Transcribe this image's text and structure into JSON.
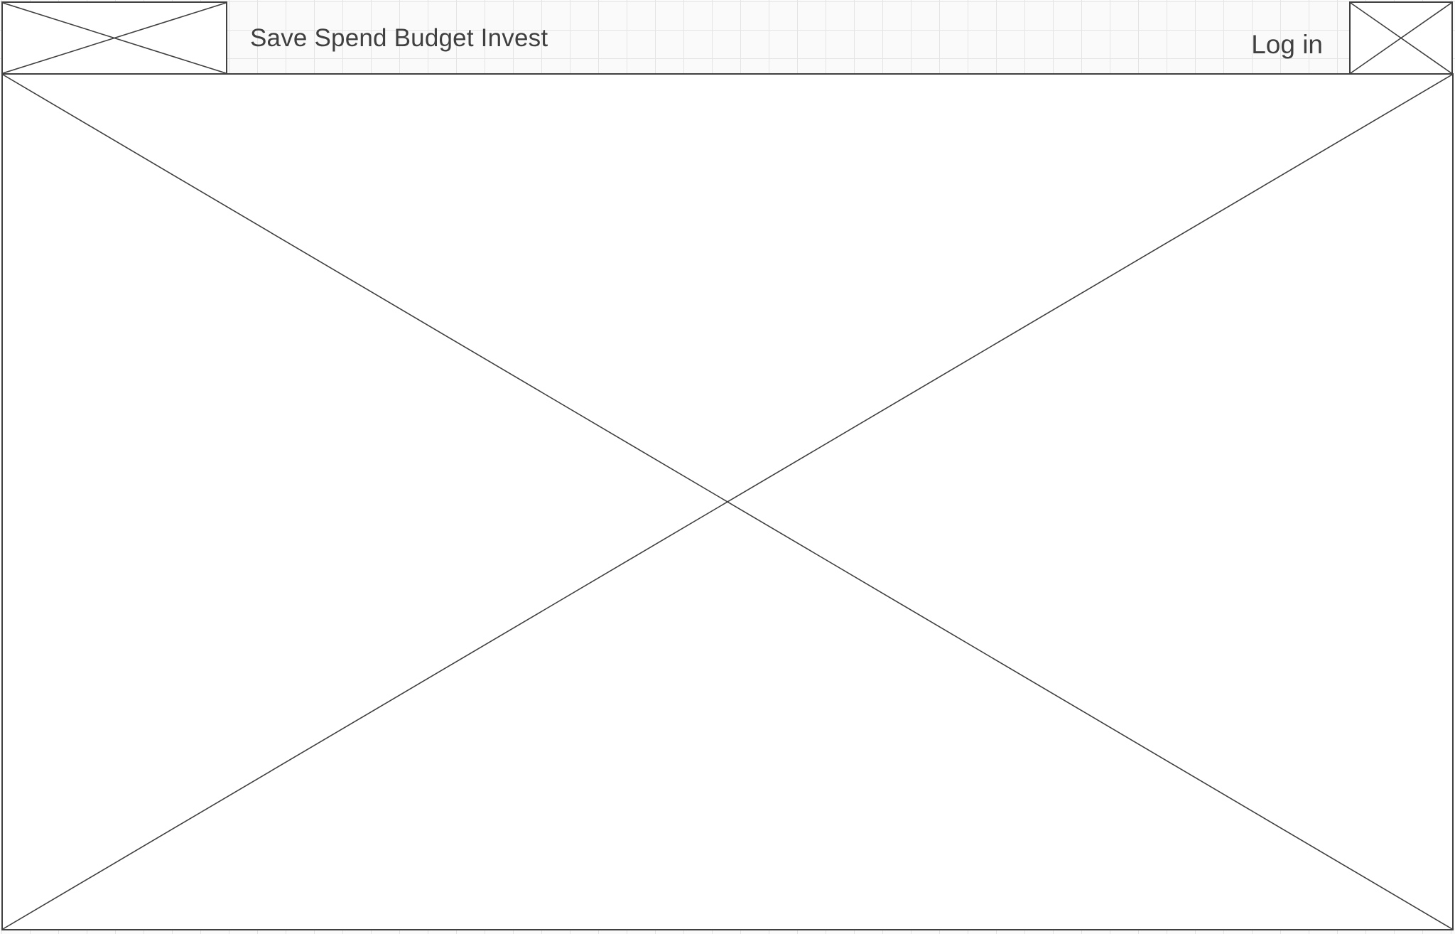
{
  "header": {
    "nav_text": "Save Spend Budget Invest",
    "login_label": "Log in"
  },
  "colors": {
    "stroke": "#404040",
    "grid": "#e4e4e4",
    "background": "#ffffff"
  },
  "placeholders": {
    "logo": "image-placeholder-icon",
    "avatar": "image-placeholder-icon",
    "hero": "image-placeholder-icon"
  }
}
